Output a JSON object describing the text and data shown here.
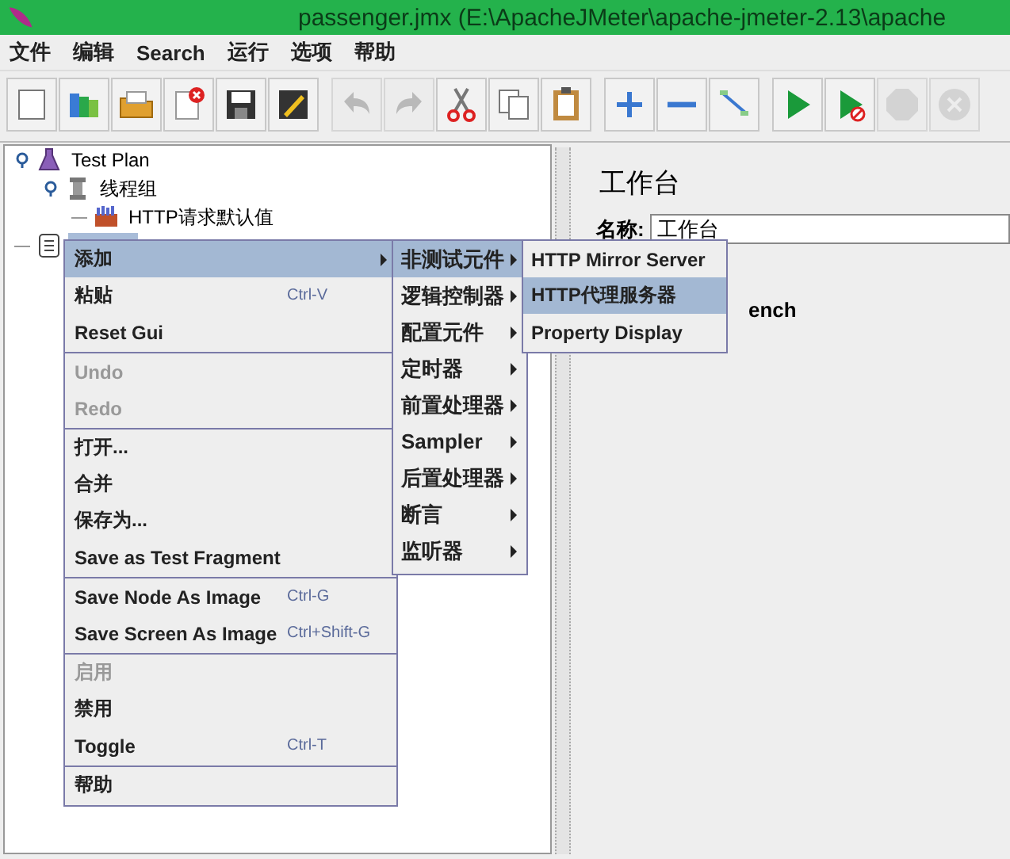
{
  "window": {
    "title": "passenger.jmx (E:\\ApacheJMeter\\apache-jmeter-2.13\\apache"
  },
  "menubar": [
    "文件",
    "编辑",
    "Search",
    "运行",
    "选项",
    "帮助"
  ],
  "toolbar_groups": [
    [
      {
        "kind": "new",
        "disabled": false
      },
      {
        "kind": "templates",
        "disabled": false
      },
      {
        "kind": "open",
        "disabled": false
      },
      {
        "kind": "close",
        "disabled": false
      },
      {
        "kind": "save",
        "disabled": false
      },
      {
        "kind": "edit",
        "disabled": false
      }
    ],
    [
      {
        "kind": "undo",
        "disabled": true
      },
      {
        "kind": "redo",
        "disabled": true
      },
      {
        "kind": "cut",
        "disabled": false
      },
      {
        "kind": "copy",
        "disabled": false
      },
      {
        "kind": "paste",
        "disabled": false
      }
    ],
    [
      {
        "kind": "expand",
        "disabled": false
      },
      {
        "kind": "collapse",
        "disabled": false
      },
      {
        "kind": "toggle",
        "disabled": false
      }
    ],
    [
      {
        "kind": "start",
        "disabled": false
      },
      {
        "kind": "start-no-pause",
        "disabled": false
      },
      {
        "kind": "stop",
        "disabled": true
      },
      {
        "kind": "shutdown",
        "disabled": true
      }
    ]
  ],
  "tree": [
    {
      "label": "Test Plan",
      "kind": "plan",
      "selected": false,
      "expanded": true,
      "children": [
        {
          "label": "线程组",
          "kind": "threads",
          "selected": false,
          "expanded": true,
          "children": [
            {
              "label": "HTTP请求默认值",
              "kind": "config",
              "selected": false
            }
          ]
        }
      ]
    },
    {
      "kind": "workbench",
      "selected": true
    }
  ],
  "right_panel": {
    "title": "工作台",
    "name_label": "名称:",
    "name_value": "工作台",
    "hidden_text": "ench"
  },
  "context_menu": [
    [
      {
        "label": "添加",
        "selected": true,
        "disabled": false,
        "submenu": true
      },
      {
        "label": "粘贴",
        "shortcut": "Ctrl-V",
        "selected": false,
        "disabled": false,
        "submenu": false
      },
      {
        "label": "Reset Gui",
        "selected": false,
        "disabled": false,
        "submenu": false
      }
    ],
    [
      {
        "label": "Undo",
        "selected": false,
        "disabled": true,
        "submenu": false
      },
      {
        "label": "Redo",
        "selected": false,
        "disabled": true,
        "submenu": false
      }
    ],
    [
      {
        "label": "打开...",
        "selected": false,
        "disabled": false,
        "submenu": false
      },
      {
        "label": "合并",
        "selected": false,
        "disabled": false,
        "submenu": false
      },
      {
        "label": "保存为...",
        "selected": false,
        "disabled": false,
        "submenu": false
      },
      {
        "label": "Save as Test Fragment",
        "selected": false,
        "disabled": false,
        "submenu": false
      }
    ],
    [
      {
        "label": "Save Node As Image",
        "shortcut": "Ctrl-G",
        "selected": false,
        "disabled": false,
        "submenu": false
      },
      {
        "label": "Save Screen As Image",
        "shortcut": "Ctrl+Shift-G",
        "selected": false,
        "disabled": false,
        "submenu": false
      }
    ],
    [
      {
        "label": "启用",
        "selected": false,
        "disabled": true,
        "submenu": false
      },
      {
        "label": "禁用",
        "selected": false,
        "disabled": false,
        "submenu": false
      },
      {
        "label": "Toggle",
        "shortcut": "Ctrl-T",
        "selected": false,
        "disabled": false,
        "submenu": false
      }
    ],
    [
      {
        "label": "帮助",
        "selected": false,
        "disabled": false,
        "submenu": false
      }
    ]
  ],
  "add_submenu": [
    {
      "label": "非测试元件",
      "selected": true,
      "submenu": true
    },
    {
      "label": "逻辑控制器",
      "selected": false,
      "submenu": true
    },
    {
      "label": "配置元件",
      "selected": false,
      "submenu": true
    },
    {
      "label": "定时器",
      "selected": false,
      "submenu": true
    },
    {
      "label": "前置处理器",
      "selected": false,
      "submenu": true
    },
    {
      "label": "Sampler",
      "selected": false,
      "submenu": true
    },
    {
      "label": "后置处理器",
      "selected": false,
      "submenu": true
    },
    {
      "label": "断言",
      "selected": false,
      "submenu": true
    },
    {
      "label": "监听器",
      "selected": false,
      "submenu": true
    }
  ],
  "non_test_submenu": [
    {
      "label": "HTTP Mirror Server",
      "selected": false
    },
    {
      "label": "HTTP代理服务器",
      "selected": true
    },
    {
      "label": "Property Display",
      "selected": false
    }
  ]
}
